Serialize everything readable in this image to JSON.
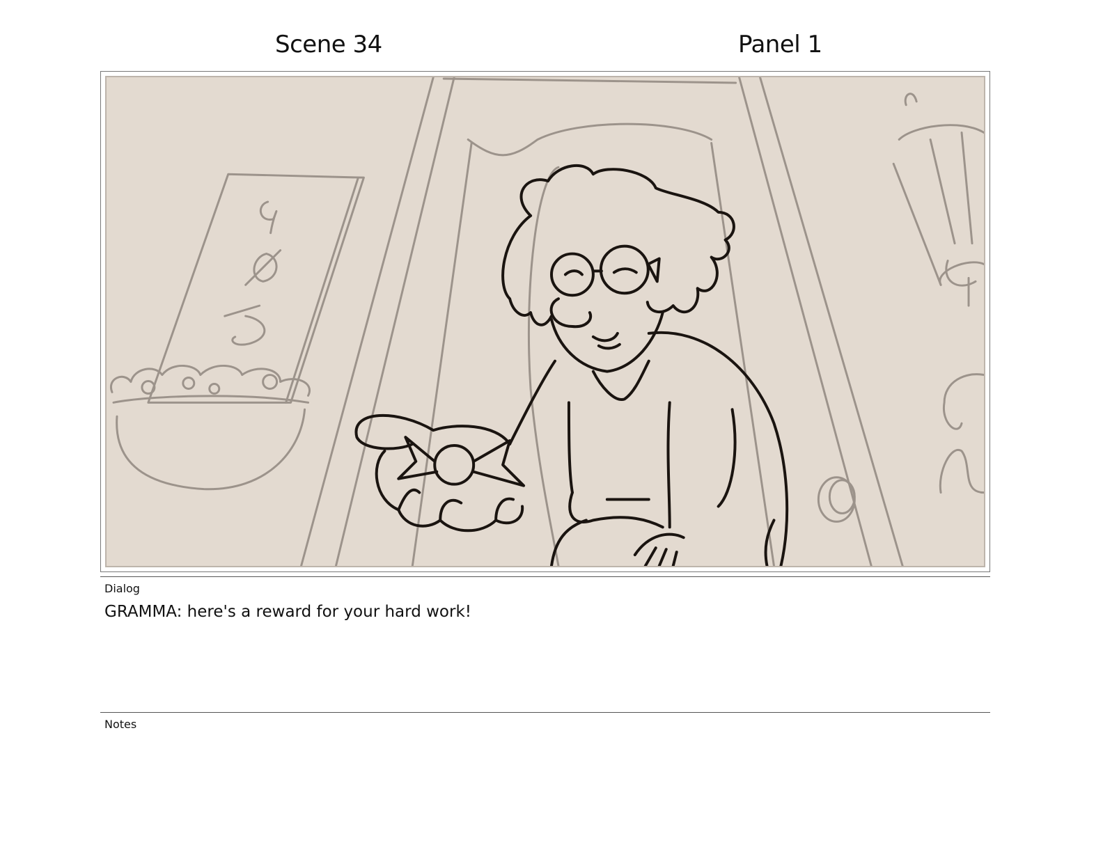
{
  "header": {
    "scene": "Scene 34",
    "panel": "Panel 1"
  },
  "dialog": {
    "label": "Dialog",
    "text": "GRAMMA: here's a reward for your hard work!"
  },
  "notes": {
    "label": "Notes",
    "text": ""
  },
  "colors": {
    "background": "#e3dad0",
    "sketch_light": "#9c938b",
    "sketch_ink": "#1a1410"
  }
}
